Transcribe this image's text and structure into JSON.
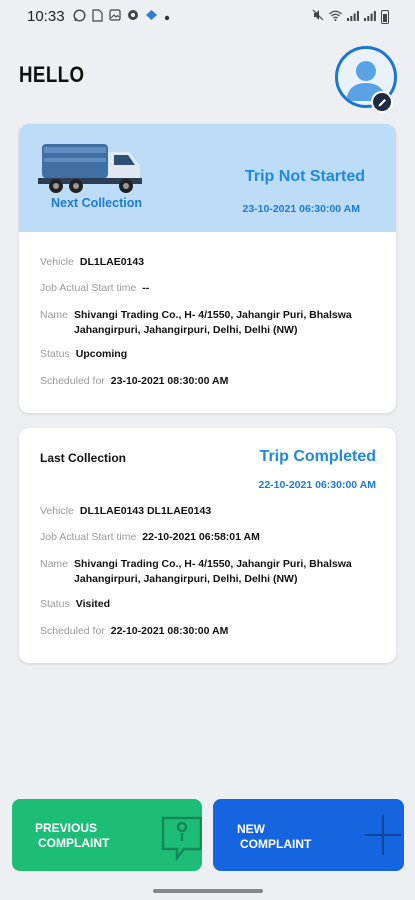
{
  "status_bar": {
    "time": "10:33",
    "icons": [
      "whatsapp-icon",
      "sim-icon",
      "gallery-icon",
      "sync-icon",
      "app-icon",
      "dot"
    ],
    "right_icons": [
      "mute-icon",
      "wifi-icon",
      "signal-icon",
      "signal-icon",
      "battery-icon"
    ]
  },
  "greeting": "HELLO",
  "next_collection": {
    "label": "Next Collection",
    "status": "Trip Not Started",
    "date": "23-10-2021 06:30:00 AM",
    "vehicle_label": "Vehicle",
    "vehicle": "DL1LAE0143",
    "start_label": "Job Actual Start time",
    "start": "--",
    "name_label": "Name",
    "name": "Shivangi Trading Co., H- 4/1550, Jahangir Puri, Bhalswa Jahangirpuri, Jahangirpuri, Delhi, Delhi (NW)",
    "status_label": "Status",
    "status_value": "Upcoming",
    "scheduled_label": "Scheduled for",
    "scheduled": "23-10-2021 08:30:00 AM"
  },
  "last_collection": {
    "title": "Last Collection",
    "status": "Trip Completed",
    "date": "22-10-2021 06:30:00 AM",
    "vehicle_label": "Vehicle",
    "vehicle": "DL1LAE0143 DL1LAE0143",
    "start_label": "Job Actual Start time",
    "start": "22-10-2021 06:58:01 AM",
    "name_label": "Name",
    "name": "Shivangi Trading Co., H- 4/1550, Jahangir Puri, Bhalswa Jahangirpuri, Jahangirpuri, Delhi, Delhi (NW)",
    "status_label": "Status",
    "status_value": "Visited",
    "scheduled_label": "Scheduled for",
    "scheduled": "22-10-2021 08:30:00 AM"
  },
  "buttons": {
    "previous_line1": "PREVIOUS",
    "previous_line2": "COMPLAINT",
    "new_line1": "NEW",
    "new_line2": "COMPLAINT"
  },
  "colors": {
    "accent_blue": "#1e88e5",
    "header_bg": "#bcdcf8",
    "previous_btn": "#1dbd78",
    "new_btn": "#1565e0"
  }
}
